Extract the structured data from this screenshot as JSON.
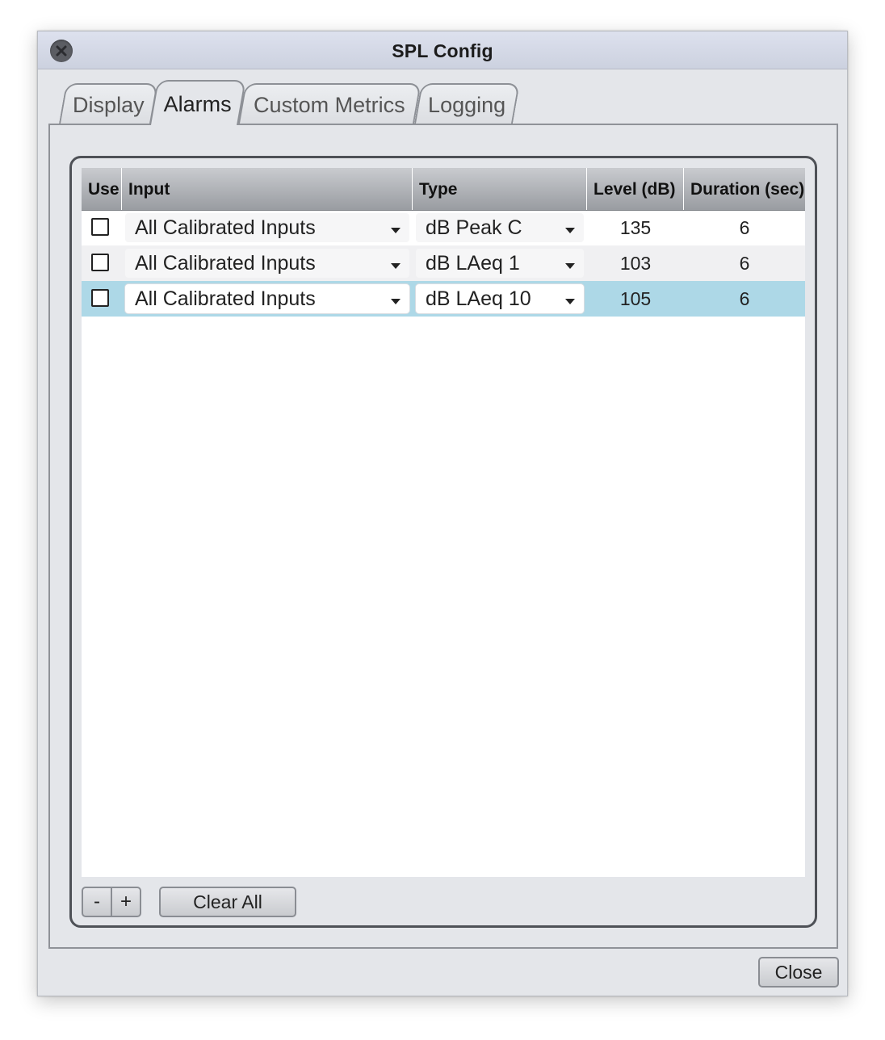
{
  "window": {
    "title": "SPL Config"
  },
  "tabs": [
    {
      "label": "Display"
    },
    {
      "label": "Alarms"
    },
    {
      "label": "Custom Metrics"
    },
    {
      "label": "Logging"
    }
  ],
  "active_tab": "Alarms",
  "table": {
    "columns": [
      "Use",
      "Input",
      "Type",
      "Level (dB)",
      "Duration (sec)"
    ],
    "rows": [
      {
        "use": false,
        "input": "All Calibrated Inputs",
        "type": "dB Peak C",
        "level": "135",
        "duration": "6",
        "selected": false
      },
      {
        "use": false,
        "input": "All Calibrated Inputs",
        "type": "dB LAeq 1",
        "level": "103",
        "duration": "6",
        "selected": false
      },
      {
        "use": false,
        "input": "All Calibrated Inputs",
        "type": "dB LAeq 10",
        "level": "105",
        "duration": "6",
        "selected": true
      }
    ]
  },
  "buttons": {
    "remove": "-",
    "add": "+",
    "clear_all": "Clear All",
    "close": "Close"
  },
  "colors": {
    "selected_row": "#add8e7",
    "window_bg": "#e4e6ea"
  }
}
